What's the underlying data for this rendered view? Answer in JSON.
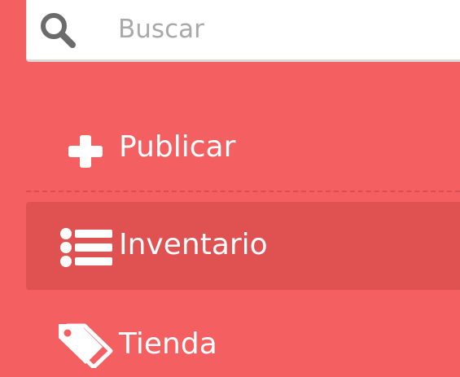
{
  "search": {
    "icon": "search-icon",
    "placeholder": "Buscar"
  },
  "menu": {
    "items": [
      {
        "label": "Publicar",
        "icon": "plus-icon",
        "active": false
      },
      {
        "label": "Inventario",
        "icon": "list-icon",
        "active": true
      },
      {
        "label": "Tienda",
        "icon": "tags-icon",
        "active": false
      }
    ]
  },
  "colors": {
    "sidebar_bg": "#f45f61",
    "active_item_bg": "#e05152",
    "text": "#ffffff",
    "search_bg": "#ffffff",
    "search_icon": "#6b6b6b",
    "placeholder": "#a9a9a9"
  }
}
